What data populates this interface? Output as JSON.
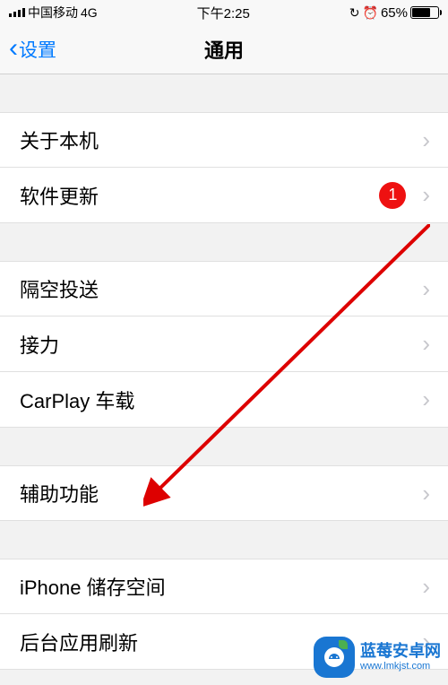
{
  "statusbar": {
    "carrier": "中国移动",
    "network": "4G",
    "time": "下午2:25",
    "battery_pct": "65%"
  },
  "nav": {
    "back_label": "设置",
    "title": "通用"
  },
  "rows": {
    "about": "关于本机",
    "update": "软件更新",
    "update_badge": "1",
    "airdrop": "隔空投送",
    "handoff": "接力",
    "carplay": "CarPlay 车载",
    "accessibility": "辅助功能",
    "storage": "iPhone 储存空间",
    "background_refresh": "后台应用刷新"
  },
  "watermark": {
    "title": "蓝莓安卓网",
    "url": "www.lmkjst.com"
  }
}
